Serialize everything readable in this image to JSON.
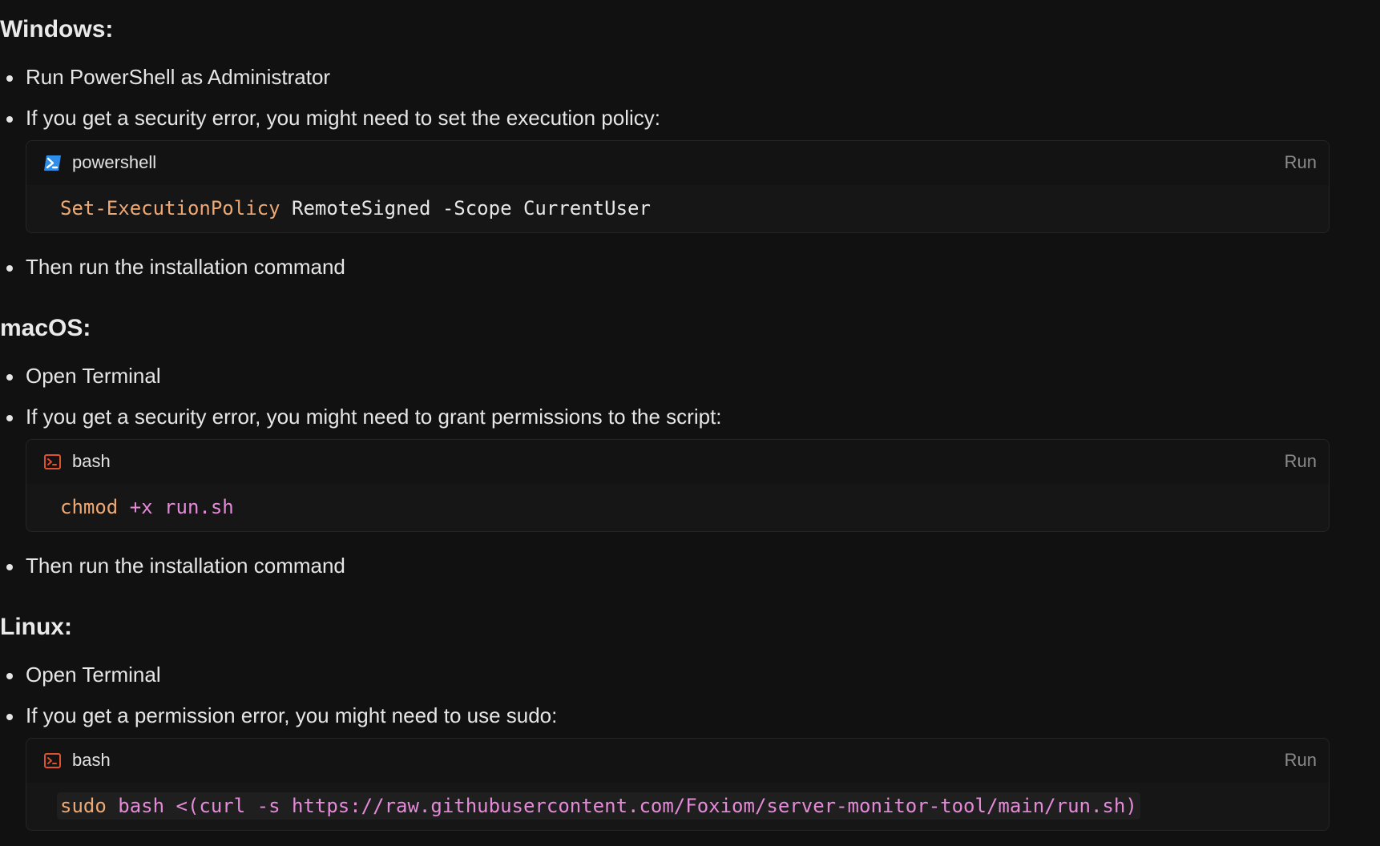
{
  "sections": [
    {
      "heading": "Windows:",
      "bullets": [
        "Run PowerShell as Administrator",
        "If you get a security error, you might need to set the execution policy:",
        "Then run the installation command"
      ],
      "code": {
        "language": "powershell",
        "icon": "powershell-icon",
        "run_label": "Run",
        "tokens": [
          "Set-ExecutionPolicy",
          " RemoteSigned -Scope CurrentUser"
        ]
      }
    },
    {
      "heading": "macOS:",
      "bullets": [
        "Open Terminal",
        "If you get a security error, you might need to grant permissions to the script:",
        "Then run the installation command"
      ],
      "code": {
        "language": "bash",
        "icon": "terminal-icon",
        "run_label": "Run",
        "tokens": [
          "chmod",
          " +x run.sh"
        ]
      }
    },
    {
      "heading": "Linux:",
      "bullets": [
        "Open Terminal",
        "If you get a permission error, you might need to use sudo:"
      ],
      "code": {
        "language": "bash",
        "icon": "terminal-icon",
        "run_label": "Run",
        "tokens": [
          "sudo",
          " bash <(curl -s https://raw.githubusercontent.com/Foxiom/server-monitor-tool/main/run.sh)"
        ]
      }
    }
  ],
  "colors": {
    "background": "#111111",
    "command": "#f0a872",
    "argument": "#e58ad9",
    "powershell_icon": "#2f8fe8",
    "terminal_icon": "#e0522e"
  }
}
